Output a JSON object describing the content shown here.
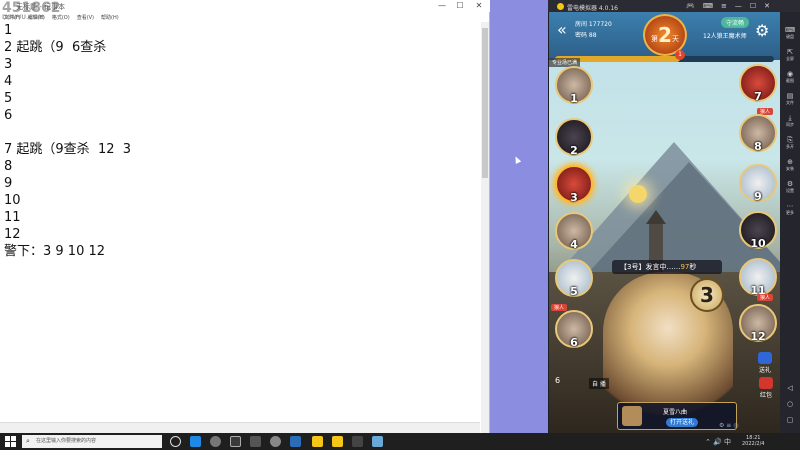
{
  "notepad": {
    "title": "无标题 - 记事本",
    "window_buttons": [
      "—",
      "☐",
      "✕"
    ],
    "menu": [
      "文件(F)",
      "编辑(E)",
      "格式(O)",
      "查看(V)",
      "帮助(H)"
    ],
    "lines": [
      "1",
      "2 起跳（9  6查杀",
      "3",
      "4",
      "5",
      "6",
      "",
      "7 起跳（9查杀  12  3",
      "8",
      "9",
      "10",
      "11",
      "12",
      "警下：3 9 10 12"
    ]
  },
  "watermark": {
    "text": "451862",
    "sub": "DOUYU.COM"
  },
  "emulator": {
    "title": "雷电模拟器 4.0.16",
    "toolbar_icons": [
      "gamepad-icon",
      "keyboard-icon",
      "menu-icon",
      "minimize-icon",
      "restore-icon",
      "close-icon"
    ],
    "side_items": [
      {
        "icon": "⌨",
        "label": "键盘"
      },
      {
        "icon": "⇱",
        "label": "全屏"
      },
      {
        "icon": "◉",
        "label": "截图"
      },
      {
        "icon": "▤",
        "label": "文件"
      },
      {
        "icon": "⤓",
        "label": "同步"
      },
      {
        "icon": "⎘",
        "label": "多开"
      },
      {
        "icon": "⊕",
        "label": "安装"
      },
      {
        "icon": "⚙",
        "label": "设置"
      },
      {
        "icon": "⋯",
        "label": "更多"
      }
    ],
    "side_bottom": [
      "◁",
      "○",
      "▢"
    ]
  },
  "game": {
    "room_label": "房间 177720",
    "password_label": "密码 88",
    "day_number": "2",
    "day_prefix": "第",
    "day_suffix": "天",
    "flow_badge": "守流畅",
    "mode_label": "12人狼王魔术师",
    "progress_number": "1",
    "progress_fraction": 0.57,
    "corner_tag": "专业场已满",
    "speak_prefix": "【3号】发言中……",
    "speak_seconds": "97",
    "speak_unit": "秒",
    "current_speaker": "3",
    "left_seats": [
      "1",
      "2",
      "3",
      "4",
      "5",
      "6"
    ],
    "right_seats": [
      "7",
      "8",
      "9",
      "10",
      "11",
      "12"
    ],
    "seat_tags": {
      "left_6": "狼人",
      "right_8": "狼人",
      "right_12": "狼人"
    },
    "bottom_panel": {
      "label": "夏雪八曲",
      "button": "打开送礼"
    },
    "auto_label": "自 播",
    "seat6_extra": "6",
    "gift_label": "送礼",
    "redpack_label": "红包",
    "colors": {
      "accent": "#e3a82a",
      "panel": "#2c5f88",
      "wolf_tag": "#d8463a"
    }
  },
  "taskbar": {
    "search_placeholder": "在这里输入你要搜索的内容",
    "time": "18:21",
    "date": "2022/2/4"
  }
}
